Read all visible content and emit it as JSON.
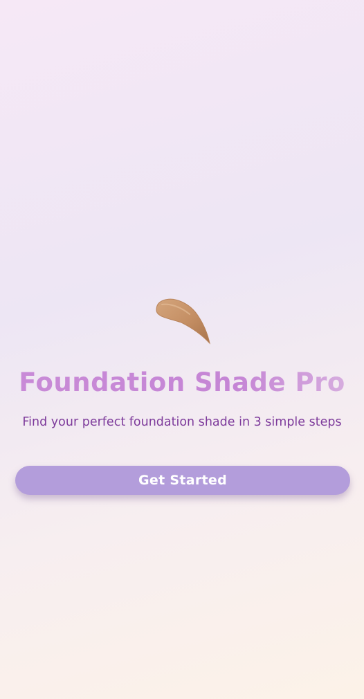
{
  "app": {
    "title": "Foundation Shade Pro",
    "tagline": "Find your perfect foundation shade in 3 simple steps"
  },
  "hero": {
    "icon": "foundation-swatch-icon",
    "swatch_color": "#c89468"
  },
  "actions": {
    "get_started_label": "Get Started"
  },
  "colors": {
    "title_gradient_start": "#c98bd7",
    "title_gradient_end": "#d9b3e0",
    "subtitle": "#7d3a9b",
    "button_bg": "#b39ddb",
    "button_text": "#ffffff"
  }
}
